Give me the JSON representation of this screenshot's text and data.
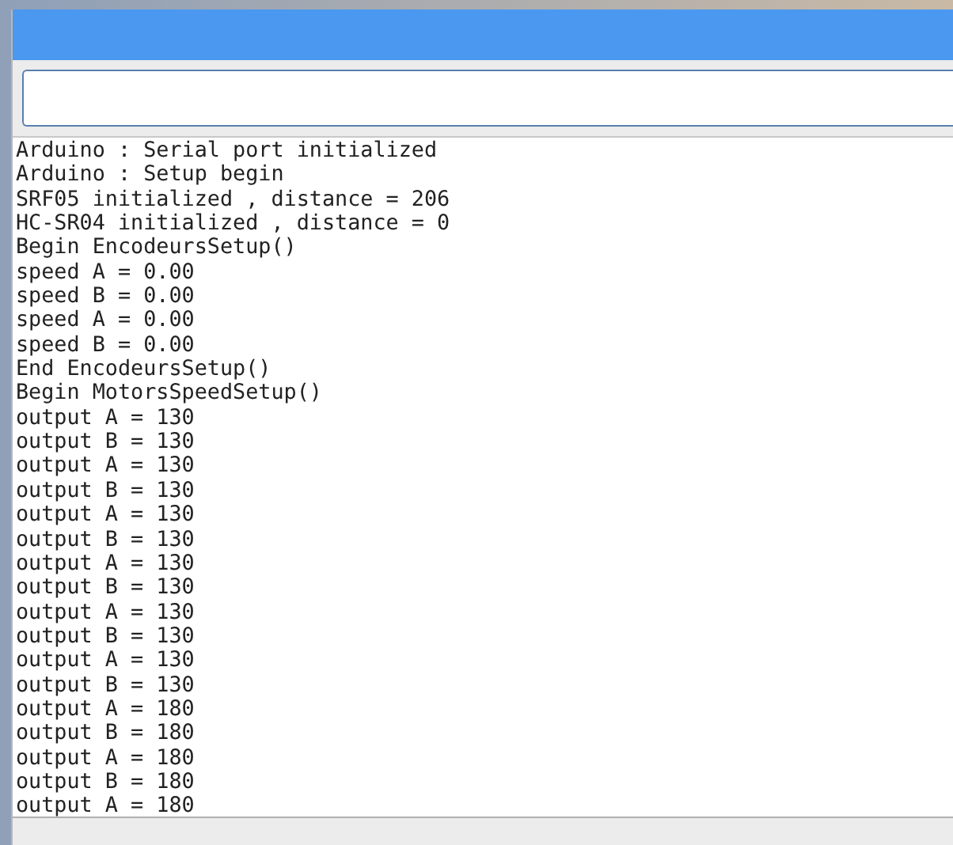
{
  "output_lines": [
    "Arduino : Serial port initialized",
    "Arduino : Setup begin",
    "SRF05 initialized , distance = 206",
    "HC-SR04 initialized , distance = 0",
    "Begin EncodeursSetup()",
    "speed A = 0.00",
    "speed B = 0.00",
    "speed A = 0.00",
    "speed B = 0.00",
    "End EncodeursSetup()",
    "Begin MotorsSpeedSetup()",
    "output A = 130",
    "output B = 130",
    "output A = 130",
    "output B = 130",
    "output A = 130",
    "output B = 130",
    "output A = 130",
    "output B = 130",
    "output A = 130",
    "output B = 130",
    "output A = 130",
    "output B = 130",
    "output A = 180",
    "output B = 180",
    "output A = 180",
    "output B = 180",
    "output A = 180"
  ]
}
